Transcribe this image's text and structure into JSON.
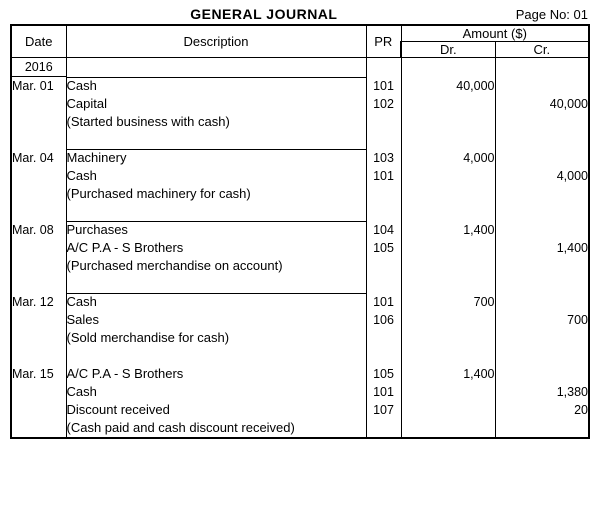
{
  "header": {
    "title": "GENERAL JOURNAL",
    "page_label": "Page No: 01"
  },
  "columns": {
    "date": "Date",
    "description": "Description",
    "pr": "PR",
    "amount": "Amount ($)",
    "dr": "Dr.",
    "cr": "Cr."
  },
  "year": "2016",
  "entries": [
    {
      "date": "Mar. 01",
      "lines": [
        {
          "type": "debit",
          "desc": "Cash",
          "pr": "101",
          "dr": "40,000",
          "cr": ""
        },
        {
          "type": "credit",
          "desc": "Capital",
          "pr": "102",
          "dr": "",
          "cr": "40,000"
        }
      ],
      "narration": "(Started business with cash)"
    },
    {
      "date": "Mar. 04",
      "lines": [
        {
          "type": "debit",
          "desc": "Machinery",
          "pr": "103",
          "dr": "4,000",
          "cr": ""
        },
        {
          "type": "credit",
          "desc": "Cash",
          "pr": "101",
          "dr": "",
          "cr": "4,000"
        }
      ],
      "narration": "(Purchased machinery for cash)"
    },
    {
      "date": "Mar. 08",
      "lines": [
        {
          "type": "debit",
          "desc": "Purchases",
          "pr": "104",
          "dr": "1,400",
          "cr": ""
        },
        {
          "type": "credit",
          "desc": "A/C P.A - S Brothers",
          "pr": "105",
          "dr": "",
          "cr": "1,400"
        }
      ],
      "narration": "(Purchased merchandise on account)"
    },
    {
      "date": "Mar. 12",
      "lines": [
        {
          "type": "debit",
          "desc": "Cash",
          "pr": "101",
          "dr": "700",
          "cr": ""
        },
        {
          "type": "credit",
          "desc": "Sales",
          "pr": "106",
          "dr": "",
          "cr": "700"
        }
      ],
      "narration": "(Sold merchandise for cash)"
    },
    {
      "date": "Mar. 15",
      "lines": [
        {
          "type": "debit",
          "desc": "A/C P.A - S Brothers",
          "pr": "105",
          "dr": "1,400",
          "cr": ""
        },
        {
          "type": "credit",
          "desc": "Cash",
          "pr": "101",
          "dr": "",
          "cr": "1,380"
        },
        {
          "type": "credit",
          "desc": "Discount received",
          "pr": "107",
          "dr": "",
          "cr": "20"
        }
      ],
      "narration": "(Cash paid and cash discount received)"
    }
  ]
}
